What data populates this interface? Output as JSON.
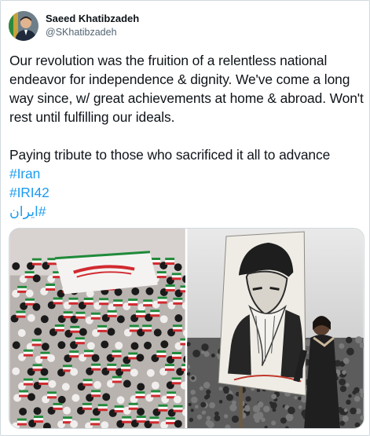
{
  "author": {
    "name": "Saeed Khatibzadeh",
    "handle": "@SKhatibzadeh"
  },
  "tweet": {
    "paragraph1": "Our revolution was the fruition of a relentless national endeavor for independence & dignity. We've come a long way since, w/ great achievements at home & abroad. Won't rest until fulfilling our ideals.",
    "paragraph2": "Paying tribute to those who sacrificed it all to advance",
    "hashtags": [
      "#Iran",
      "#IRI42",
      "#ایران"
    ]
  },
  "media": [
    {
      "icon": "crowd-with-flags-photo"
    },
    {
      "icon": "portrait-placard-photo"
    }
  ],
  "colors": {
    "link": "#1d9bf0",
    "text": "#0f1419",
    "secondary": "#536471",
    "border": "#cfd9de"
  }
}
